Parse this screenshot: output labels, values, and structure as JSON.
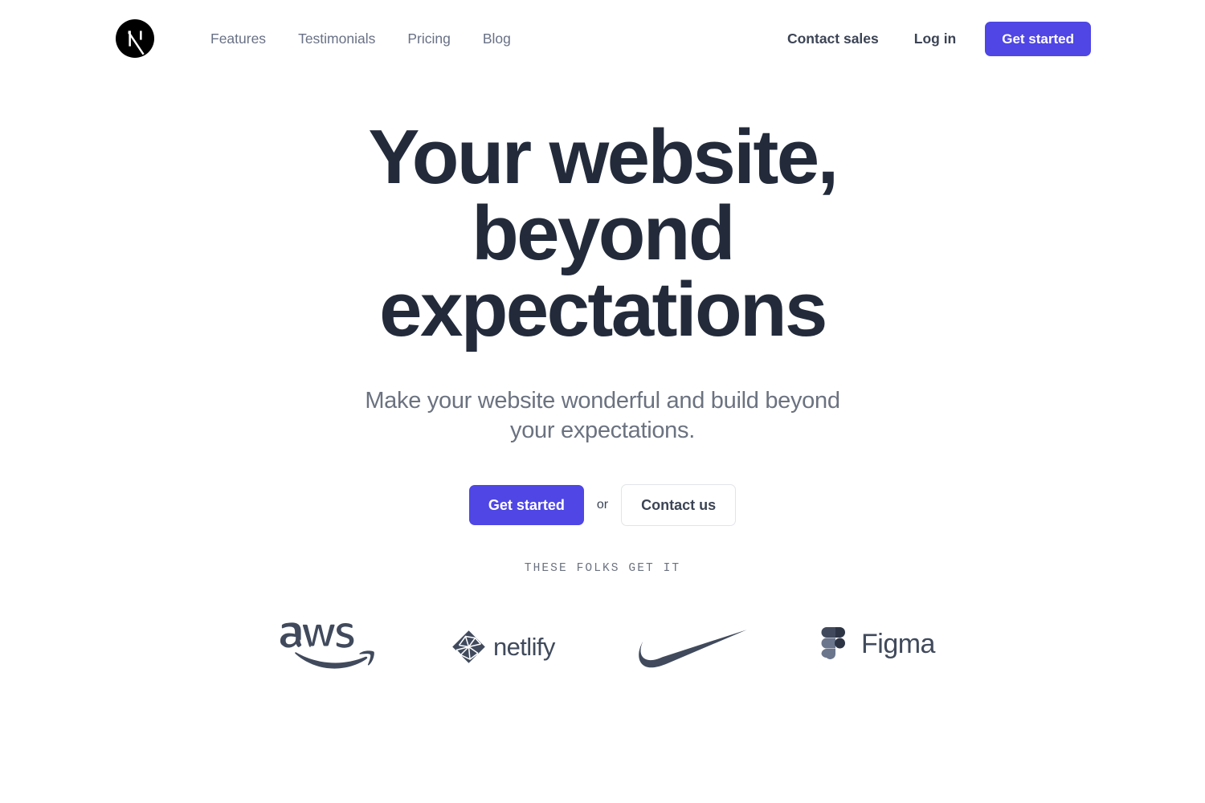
{
  "brand": {
    "icon": "nextjs-logo-icon",
    "letter": "N",
    "color": "#000000"
  },
  "nav": {
    "links": [
      {
        "label": "Features"
      },
      {
        "label": "Testimonials"
      },
      {
        "label": "Pricing"
      },
      {
        "label": "Blog"
      }
    ],
    "right": {
      "contact_sales_label": "Contact sales",
      "login_label": "Log in",
      "get_started_label": "Get started"
    }
  },
  "hero": {
    "headline": "Your website, beyond expectations",
    "subhead": "Make your website wonderful and build beyond your expectations.",
    "primary_cta_label": "Get started",
    "separator_label": "or",
    "secondary_cta_label": "Contact us"
  },
  "logo_cloud": {
    "eyebrow": "THESE FOLKS GET IT",
    "logos": [
      {
        "name": "aws-logo",
        "label": "aws"
      },
      {
        "name": "netlify-logo",
        "label": "netlify"
      },
      {
        "name": "nike-logo",
        "label": "Nike"
      },
      {
        "name": "figma-logo",
        "label": "Figma"
      }
    ]
  },
  "colors": {
    "accent": "#4f46e5",
    "headline": "#232b3b",
    "body_text": "#6b7280",
    "strong_text": "#3c4455",
    "logo_slate": "#404a5c",
    "border": "#e1e4e9",
    "background": "#ffffff"
  }
}
